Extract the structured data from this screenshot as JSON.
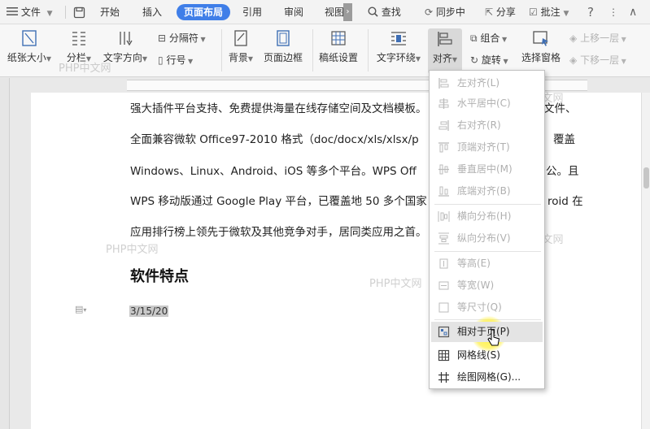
{
  "tabs": {
    "file": "文件",
    "home": "开始",
    "insert": "插入",
    "layout": "页面布局",
    "references": "引用",
    "review": "审阅",
    "view": "视图",
    "search": "查找",
    "sync": "同步中",
    "share": "分享",
    "comment": "批注"
  },
  "ribbon": {
    "paper_size": "纸张大小",
    "columns": "分栏",
    "text_direction": "文字方向",
    "separator": "分隔符",
    "line_number": "行号",
    "background": "背景",
    "page_border": "页面边框",
    "draft_settings": "稿纸设置",
    "text_wrap": "文字环绕",
    "align": "对齐",
    "group": "组合",
    "rotate": "旋转",
    "selection_pane": "选择窗格",
    "bring_forward": "上移一层",
    "send_backward": "下移一层"
  },
  "document": {
    "lines": [
      "强大插件平台支持、免费提供海量在线存储空间及文档模板。",
      "全面兼容微软 Office97-2010 格式（doc/docx/xls/xlsx/p",
      "Windows、Linux、Android、iOS 等多个平台。WPS Off",
      "WPS 移动版通过 Google Play 平台，已覆盖地 50 多个国家",
      "应用排行榜上领先于微软及其他竞争对手，居同类应用之首。"
    ],
    "line_tails": [
      "文件、",
      "覆盖",
      "公。且",
      "roid 在",
      ""
    ],
    "heading": "软件特点",
    "date": "3/15/20",
    "watermark": "PHP中文网"
  },
  "align_menu": {
    "items": [
      {
        "label": "左对齐(L)",
        "icon": "align-left-icon",
        "enabled": false
      },
      {
        "label": "水平居中(C)",
        "icon": "align-center-h-icon",
        "enabled": false
      },
      {
        "label": "右对齐(R)",
        "icon": "align-right-icon",
        "enabled": false
      },
      {
        "label": "顶端对齐(T)",
        "icon": "align-top-icon",
        "enabled": false
      },
      {
        "label": "垂直居中(M)",
        "icon": "align-middle-v-icon",
        "enabled": false
      },
      {
        "label": "底端对齐(B)",
        "icon": "align-bottom-icon",
        "enabled": false
      },
      {
        "label": "横向分布(H)",
        "icon": "distribute-h-icon",
        "enabled": false
      },
      {
        "label": "纵向分布(V)",
        "icon": "distribute-v-icon",
        "enabled": false
      },
      {
        "label": "等高(E)",
        "icon": "same-height-icon",
        "enabled": false
      },
      {
        "label": "等宽(W)",
        "icon": "same-width-icon",
        "enabled": false
      },
      {
        "label": "等尺寸(Q)",
        "icon": "same-size-icon",
        "enabled": false
      },
      {
        "label": "相对于页(P)",
        "icon": "relative-to-page-icon",
        "enabled": true
      },
      {
        "label": "网格线(S)",
        "icon": "gridlines-icon",
        "enabled": true
      },
      {
        "label": "绘图网格(G)...",
        "icon": "drawing-grid-icon",
        "enabled": true
      }
    ]
  },
  "colors": {
    "accent": "#3f7ee8",
    "highlight": "#e4e4e4",
    "disabled_text": "#b0b0b0"
  }
}
